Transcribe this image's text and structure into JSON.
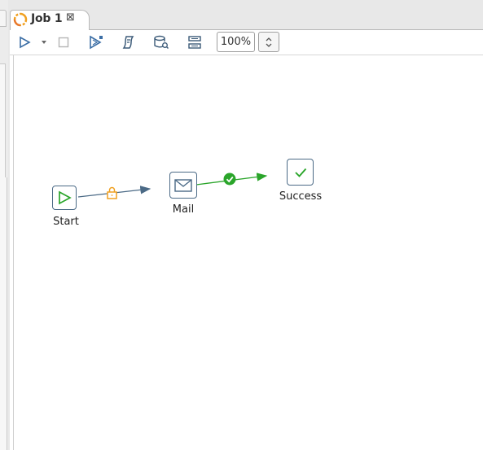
{
  "tab": {
    "title": "Job 1",
    "close_glyph": "⊠",
    "icon": "job-icon"
  },
  "toolbar": {
    "zoom_value": "100%",
    "buttons": [
      "run-icon",
      "run-dropdown-icon",
      "stop-icon",
      "debug-run-icon",
      "script-icon",
      "db-search-icon",
      "layout-icon"
    ]
  },
  "canvas": {
    "nodes": [
      {
        "id": "start",
        "label": "Start",
        "icon": "play-icon",
        "color": "#2aa52a"
      },
      {
        "id": "mail",
        "label": "Mail",
        "icon": "mail-icon",
        "color": "#4b6a86"
      },
      {
        "id": "success",
        "label": "Success",
        "icon": "check-icon",
        "color": "#2aa52a"
      }
    ],
    "links": [
      {
        "from": "start",
        "to": "mail",
        "type": "locked",
        "color": "#4b6a86",
        "marker_color": "#f0a020"
      },
      {
        "from": "mail",
        "to": "success",
        "type": "on-success",
        "color": "#2aa52a",
        "marker_color": "#2aa52a"
      }
    ]
  }
}
